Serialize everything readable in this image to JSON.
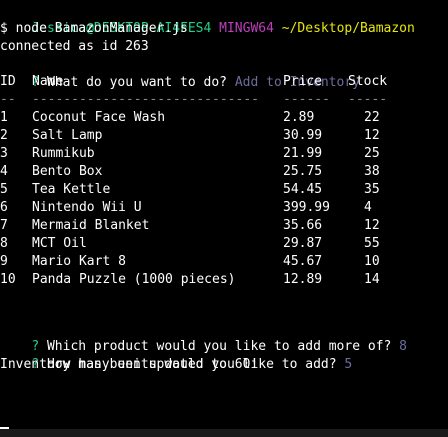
{
  "prompt_line": {
    "user_host": "Jessica@DESKTOP-AI4FES4",
    "shell": "MINGW64",
    "path": "~/Desktop/Bamazon"
  },
  "command": "$ node BamazonManager.js",
  "connection_message": "connected as id 263",
  "question_1": {
    "marker": "?",
    "text": "What do you want to do?",
    "answer": "Add to Inventory"
  },
  "table": {
    "headers": {
      "id": "ID",
      "name": "Name",
      "price": "Price",
      "stock": "Stock"
    },
    "separators": {
      "id": "--",
      "name": "-----------------------------",
      "price": "------",
      "stock": "-----"
    },
    "rows": [
      {
        "id": "1",
        "name": "Coconut Face Wash",
        "price": "2.89",
        "stock": "22"
      },
      {
        "id": "2",
        "name": "Salt Lamp",
        "price": "30.99",
        "stock": "12"
      },
      {
        "id": "3",
        "name": "Rummikub",
        "price": "21.99",
        "stock": "25"
      },
      {
        "id": "4",
        "name": "Bento Box",
        "price": "25.75",
        "stock": "38"
      },
      {
        "id": "5",
        "name": "Tea Kettle",
        "price": "54.45",
        "stock": "35"
      },
      {
        "id": "6",
        "name": "Nintendo Wii U",
        "price": "399.99",
        "stock": "4"
      },
      {
        "id": "7",
        "name": "Mermaid Blanket",
        "price": "35.66",
        "stock": "12"
      },
      {
        "id": "8",
        "name": "MCT Oil",
        "price": "29.87",
        "stock": "55"
      },
      {
        "id": "9",
        "name": "Mario Kart 8",
        "price": "45.67",
        "stock": "10"
      },
      {
        "id": "10",
        "name": "Panda Puzzle (1000 pieces)",
        "price": "12.89",
        "stock": "14"
      }
    ]
  },
  "question_2": {
    "marker": "?",
    "text": "Which product would you like to add more of?",
    "answer": "8"
  },
  "question_3": {
    "marker": "?",
    "text": "How many units would you like to add?",
    "answer": "5"
  },
  "result_message": "Inventory has been updated to 60!"
}
